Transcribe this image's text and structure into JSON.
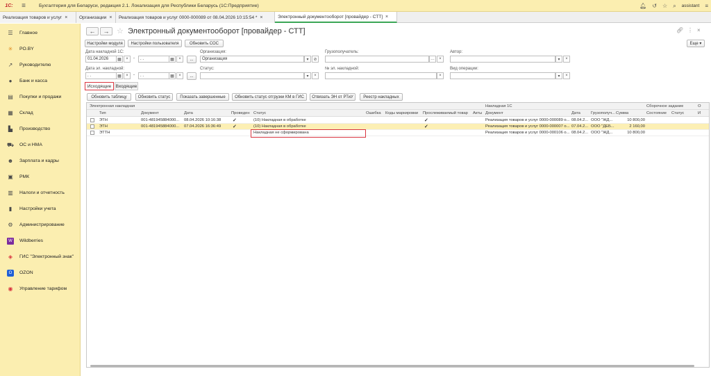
{
  "app": {
    "logo": "1С:",
    "title": "Бухгалтерия для Беларуси, редакция 2.1. Локализация для Республики Беларусь   (1С:Предприятие)",
    "user": "assistant"
  },
  "tabs": [
    {
      "label": "Реализация товаров и услуг",
      "close": "×"
    },
    {
      "label": "Организации",
      "close": "×"
    },
    {
      "label": "Реализация товаров и услуг 0000-000089 от 08.04.2026 10:15:54 *",
      "close": "×"
    },
    {
      "label": "Электронный документооборот [провайдер - СТТ]",
      "close": "×"
    }
  ],
  "sidebar": {
    "items": [
      {
        "label": "Главное",
        "icon": "menu-icon"
      },
      {
        "label": "PO.BY",
        "icon": "asterisk-icon"
      },
      {
        "label": "Руководителю",
        "icon": "trend-icon"
      },
      {
        "label": "Банк и касса",
        "icon": "bank-icon"
      },
      {
        "label": "Покупки и продажи",
        "icon": "cart-icon"
      },
      {
        "label": "Склад",
        "icon": "warehouse-icon"
      },
      {
        "label": "Производство",
        "icon": "factory-icon"
      },
      {
        "label": "ОС и НМА",
        "icon": "truck-icon"
      },
      {
        "label": "Зарплата и кадры",
        "icon": "people-icon"
      },
      {
        "label": "РМК",
        "icon": "register-icon"
      },
      {
        "label": "Налоги и отчетность",
        "icon": "chart-icon"
      },
      {
        "label": "Настройки учета",
        "icon": "book-icon"
      },
      {
        "label": "Администрирование",
        "icon": "gear-icon"
      },
      {
        "label": "Wildberries",
        "icon": "wb-icon"
      },
      {
        "label": "ГИС \"Электронный знак\"",
        "icon": "diamond-icon"
      },
      {
        "label": "OZON",
        "icon": "ozon-icon"
      },
      {
        "label": "Управление тарифом",
        "icon": "tariff-icon"
      }
    ]
  },
  "main": {
    "back": "←",
    "forward": "→",
    "title": "Электронный документооборот [провайдер - СТТ]",
    "more": "Еще ▾",
    "buttons": {
      "module_settings": "Настройки модуля",
      "user_settings": "Настройки пользователя",
      "update_cos": "Обновить СОС"
    },
    "filters": {
      "date_1c_label": "Дата накладной 1С:",
      "date_1c_from": "01.04.2026",
      "date_1c_to": ". .",
      "date_e_label": "Дата эл. накладной:",
      "date_e_from": ". .",
      "date_e_to": ". .",
      "org_label": "Организация:",
      "org_value": "Организация",
      "status_label": "Статус:",
      "consignee_label": "Грузополучатель:",
      "e_number_label": "№ эл. накладной:",
      "author_label": "Автор:",
      "op_type_label": "Вид операции:",
      "dash": "-",
      "ellipsis": "..."
    },
    "subtabs": {
      "outgoing": "Исходящие",
      "incoming": "Входящие"
    },
    "actions": {
      "refresh_table": "Обновить таблицу",
      "refresh_status": "Обновить статус",
      "show_completed": "Показать завершенные",
      "refresh_km_status": "Обновить статус отгрузки КМ в ГИС",
      "unlink_en": "Отвязать ЭН от РТиУ",
      "registry": "Реестр накладных"
    },
    "table": {
      "group_headers": {
        "e_invoice": "Электронная накладная",
        "invoice_1c": "Накладная 1С",
        "assembly": "Сборочное задание",
        "extra": "О"
      },
      "columns": {
        "type": "Тип",
        "document": "Документ",
        "date": "Дата",
        "posted": "Проведен",
        "status": "Статус",
        "error": "Ошибка",
        "marking_codes": "Коды маркировки",
        "tracked": "Прослеживаемый товар",
        "acts": "Акты",
        "doc_1c": "Документ",
        "date_1c": "Дата",
        "consignee": "Грузополуч...",
        "sum": "Сумма",
        "state": "Состояние",
        "status2": "Статус",
        "extra": "И"
      },
      "rows": [
        {
          "type": "ЭТН",
          "document": "001-481945884000...",
          "date": "08.04.2026 10:16:38",
          "posted": "✓",
          "status": "(10) Накладная в обработке",
          "tracked": "✓",
          "doc_1c": "Реализация товаров и услуг 0000-000089 о...",
          "date_1c": "08.04.2...",
          "consignee": "ООО \"ЖД...",
          "sum": "10 800,00"
        },
        {
          "type": "ЭТН",
          "document": "001-481945884000...",
          "date": "07.04.2026 16:36:49",
          "posted": "✓",
          "status": "(10) Накладная в обработке",
          "tracked": "✓",
          "doc_1c": "Реализация товаров и услуг 0000-000007 о...",
          "date_1c": "07.04.2...",
          "consignee": "ООО \"ДЕБ...",
          "sum": "2 160,00"
        },
        {
          "type": "ЭТТН",
          "document": "",
          "date": "",
          "posted": "",
          "status": "Накладная не сформирована",
          "tracked": "",
          "doc_1c": "Реализация товаров и услуг 0000-000106 о...",
          "date_1c": "08.04.2...",
          "consignee": "ООО \"ЖД...",
          "sum": "10 800,00"
        }
      ]
    }
  },
  "colors": {
    "sidebar_bg": "#fbeeb0",
    "highlight_red": "#d9343f",
    "check_green": "#2e9c3f",
    "selected_row": "#fcefb4"
  }
}
